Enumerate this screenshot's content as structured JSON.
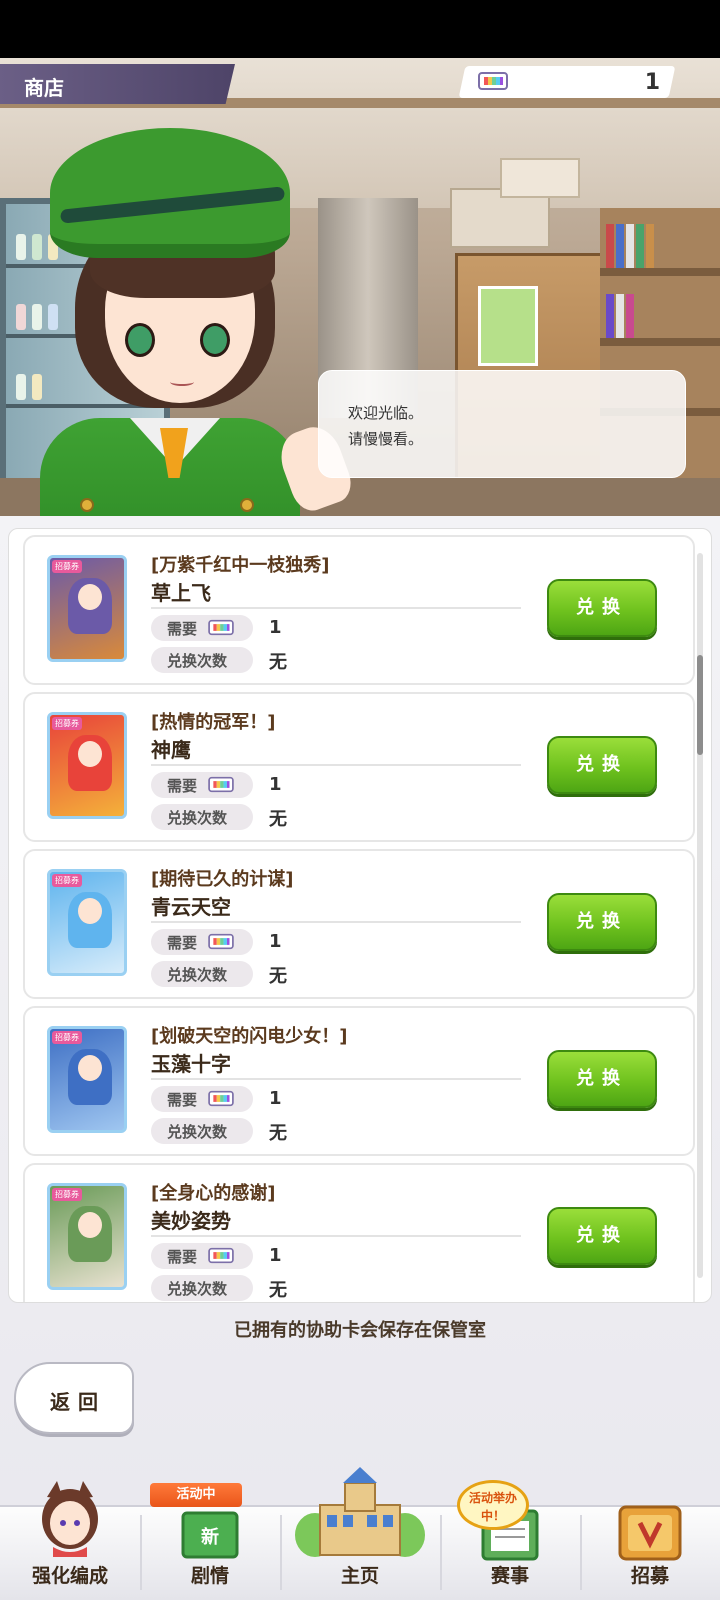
{
  "header": {
    "title": "商店",
    "ticket_count": "1"
  },
  "dialogue": {
    "line1": "欢迎光临。",
    "line2": "请慢慢看。"
  },
  "items": [
    {
      "title": "[万紫千红中一枝独秀]",
      "name": "草上飞",
      "need_label": "需要",
      "need_value": "1",
      "count_label": "兑换次数",
      "count_value": "无",
      "button": "兑换",
      "thumb_tag": "招募券",
      "thumb_colors": [
        "#6b5aa8",
        "#d98a3a"
      ]
    },
    {
      "title": "[热情的冠军！]",
      "name": "神鹰",
      "need_label": "需要",
      "need_value": "1",
      "count_label": "兑换次数",
      "count_value": "无",
      "button": "兑换",
      "thumb_tag": "招募券",
      "thumb_colors": [
        "#e8433a",
        "#f4b13a"
      ]
    },
    {
      "title": "[期待已久的计谋]",
      "name": "青云天空",
      "need_label": "需要",
      "need_value": "1",
      "count_label": "兑换次数",
      "count_value": "无",
      "button": "兑换",
      "thumb_tag": "招募券",
      "thumb_colors": [
        "#5fb4ee",
        "#d7ecfa"
      ]
    },
    {
      "title": "[划破天空的闪电少女！]",
      "name": "玉藻十字",
      "need_label": "需要",
      "need_value": "1",
      "count_label": "兑换次数",
      "count_value": "无",
      "button": "兑换",
      "thumb_tag": "招募券",
      "thumb_colors": [
        "#3e6fc4",
        "#9fc6f0"
      ]
    },
    {
      "title": "[全身心的感谢]",
      "name": "美妙姿势",
      "need_label": "需要",
      "need_value": "1",
      "count_label": "兑换次数",
      "count_value": "无",
      "button": "兑换",
      "thumb_tag": "招募券",
      "thumb_colors": [
        "#6a9b58",
        "#e8e1d0"
      ]
    }
  ],
  "storage_note": "已拥有的协助卡会保存在保管室",
  "back_button": "返回",
  "nav": {
    "items": [
      {
        "label": "强化编成",
        "icon": "character-icon"
      },
      {
        "label": "剧情",
        "icon": "story-book-icon",
        "badge": "活动中"
      },
      {
        "label": "主页",
        "icon": "home-building-icon"
      },
      {
        "label": "赛事",
        "icon": "race-icon",
        "badge": "活动举办中！"
      },
      {
        "label": "招募",
        "icon": "gacha-icon"
      }
    ]
  },
  "colors": {
    "accent_green": "#6fc21e",
    "header_purple": "#5a4f7a",
    "text_brown": "#3b2a1a"
  }
}
